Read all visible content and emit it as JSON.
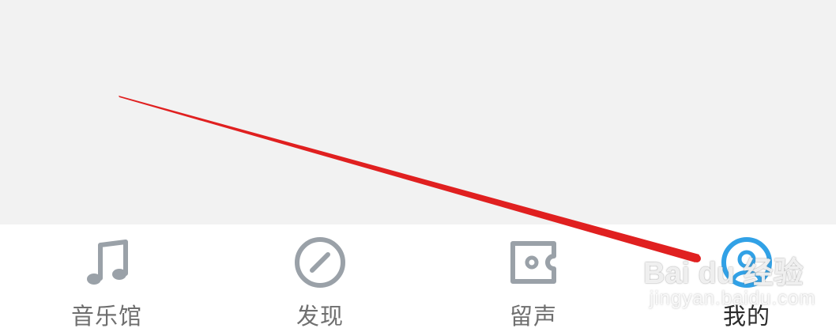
{
  "tabs": [
    {
      "label": "音乐馆",
      "icon": "music-note-icon",
      "active": false
    },
    {
      "label": "发现",
      "icon": "compass-icon",
      "active": false
    },
    {
      "label": "留声",
      "icon": "ticket-icon",
      "active": false
    },
    {
      "label": "我的",
      "icon": "profile-icon",
      "active": true
    }
  ],
  "colors": {
    "content_bg": "#f2f2f2",
    "icon_inactive": "#9aa1a8",
    "icon_active": "#31a1e6",
    "annotation_arrow": "#e02020"
  },
  "watermark": {
    "main": "Bai du 经验",
    "sub": "jingyan.baidu.com"
  }
}
